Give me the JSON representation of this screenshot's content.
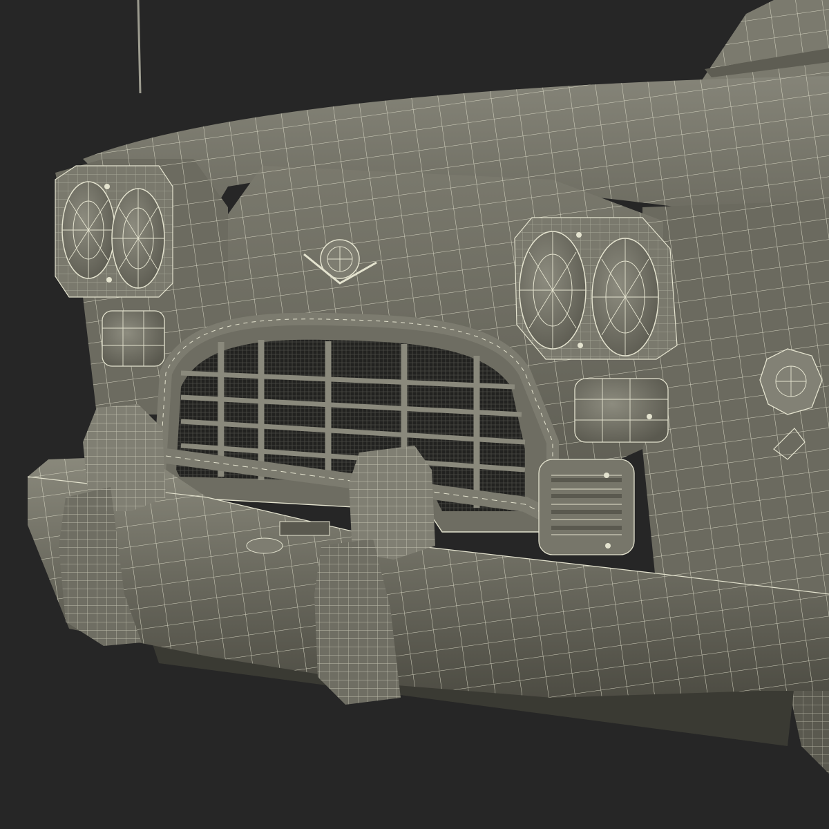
{
  "scene": {
    "background": "#262626",
    "subject": "car-front-wireframe-render",
    "colors": {
      "body": "#6f6e63",
      "body_light": "#8a897c",
      "body_dark": "#4f4e45",
      "shadow": "#3a3a33",
      "wire": "#e4e3cf",
      "grille_dark": "#1e1e1c"
    }
  }
}
